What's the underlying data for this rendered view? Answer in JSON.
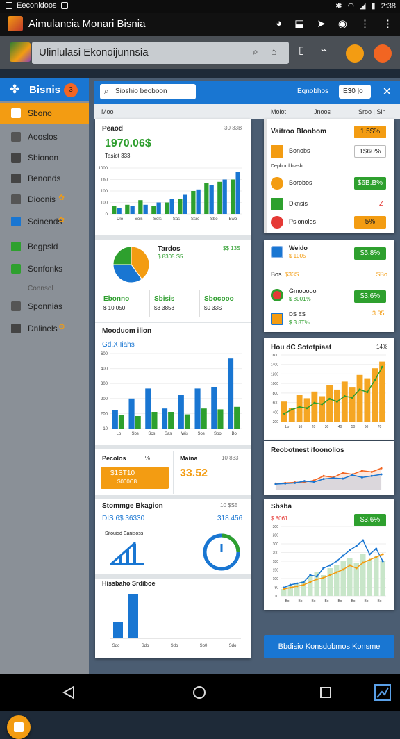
{
  "status_bar": {
    "left_text": "Eeconidoos",
    "time": "2:38"
  },
  "titlebar": {
    "title": "Aimulancia Monari Bisnia"
  },
  "address_bar": {
    "url": "Ulinlulasi Ekonoijunnsia"
  },
  "sidebar": {
    "title": "Bisnis",
    "badge": "3",
    "items": [
      {
        "label": "Sbono",
        "active": true,
        "icon": "chart-icon"
      },
      {
        "label": "Aooslos",
        "icon": "bar-icon"
      },
      {
        "label": "Sbionon",
        "icon": "doc-icon"
      },
      {
        "label": "Benonds",
        "icon": "doc-icon"
      },
      {
        "label": "Dioonis",
        "extra": "✿",
        "icon": "gear-icon"
      },
      {
        "label": "Scinends",
        "extra": "✿",
        "icon": "calendar-icon"
      },
      {
        "label": "Begpsld",
        "icon": "green-doc-icon"
      },
      {
        "label": "Sonfonks",
        "icon": "green-doc-icon"
      },
      {
        "label": "Connsol",
        "muted": true
      },
      {
        "label": "Sponnias",
        "icon": "gear-icon"
      },
      {
        "label": "Dnlinels",
        "extra": "⚙",
        "icon": "doc-icon"
      }
    ]
  },
  "toolbar": {
    "search_placeholder": "Sioshio beoboon",
    "link": "Eqnobhos",
    "button": "E30 |o",
    "close": "✕"
  },
  "column_header": {
    "c1": "Moo",
    "c2": "Moiot",
    "c3": "Jnoos",
    "c4": "Sroo | Sln"
  },
  "left": {
    "card1": {
      "title": "Peaod",
      "corner": "30 33B",
      "value": "1970.06$",
      "sub": "Tasiot 333",
      "yticks": [
        "1000",
        "160",
        "100",
        "100",
        "0"
      ],
      "xticks": [
        "Dlo",
        "Sols",
        "Sols",
        "Sas",
        "Ssro",
        "Sbo",
        "Bwo"
      ]
    },
    "pie": {
      "title": "Tardos",
      "corner": "$$ 13S",
      "sub": "$ 8305.S5",
      "slices": [
        {
          "label": "Orange",
          "value": 40,
          "color": "#f39c12"
        },
        {
          "label": "Blue",
          "value": 35,
          "color": "#1976d2"
        },
        {
          "label": "Green",
          "value": 25,
          "color": "#2ea02e"
        }
      ],
      "stats": [
        {
          "value": "Ebonno",
          "sub": "$ 10 050"
        },
        {
          "value": "Sbisis",
          "sub": "$3 3853"
        },
        {
          "value": "Sbocooo",
          "sub": "$0 33S"
        }
      ]
    },
    "card3": {
      "title": "Mooduom ilion",
      "sub": "Gd.X Iiahs",
      "yticks": [
        "600",
        "400",
        "300",
        "200",
        "200",
        "10"
      ],
      "xticks": [
        "Lo",
        "Sbs",
        "Scs",
        "Sas",
        "Wis",
        "Sos",
        "Sbo",
        "Bo"
      ]
    },
    "card4": {
      "left_title": "Pecolos",
      "left_corner": "%",
      "pill": "$1ST10",
      "pill_sub": "$000C8",
      "right_title": "Maina",
      "right_corner": "10 833",
      "right_value": "33.52"
    },
    "card5": {
      "title": "Stommge Bkagion",
      "corner": "10 $S5",
      "left_value": "DIS 6$ 36330",
      "right_value": "318.456",
      "sub": "Sitouisd Eanisoss"
    },
    "card6": {
      "title": "Hissbaho Srdiboe",
      "xticks": [
        "Sdo",
        "Sdo",
        "Sdo",
        "Sb0",
        "Sdo"
      ]
    }
  },
  "right": {
    "card1": {
      "title": "Vaitroo Blonbom",
      "pill": "1 5$%",
      "rows": [
        {
          "label": "Bonobs",
          "pill": "1$60%",
          "pill_style": "w"
        },
        {
          "label": "Depbord blasb",
          "pill": "",
          "pill_style": ""
        },
        {
          "label": "Borobos",
          "pill": "$6B.B%",
          "pill_style": "g"
        },
        {
          "label": "Dknsis",
          "pill": "Z",
          "pill_style": "x"
        },
        {
          "label": "Psionolos",
          "pill": "5%",
          "pill_style": "o"
        }
      ]
    },
    "card2": {
      "title": "Weido",
      "sub": "$ 1005",
      "pill": "$5.8%",
      "row2_label": "Bos",
      "row2_value": "$33$",
      "row2_right": "$Bo",
      "row3_title": "Gmooooo",
      "row3_sub": "$ 8001%",
      "row3_pill": "$3.6%",
      "row4_a": "DS ES",
      "row4_b": "$ 3.8T%",
      "row4_right": "3.35"
    },
    "card3": {
      "title": "Hou dC Sototpiaat",
      "corner": "14%",
      "bars": [
        30,
        20,
        40,
        35,
        45,
        38,
        55,
        48,
        60,
        52,
        70,
        65,
        80,
        90
      ],
      "line": [
        12,
        18,
        22,
        20,
        28,
        26,
        34,
        30,
        38,
        36,
        48,
        44,
        62,
        82
      ],
      "yticks": [
        "1600",
        "1400",
        "1200",
        "1000",
        "800",
        "600",
        "400",
        "200"
      ],
      "xticks": [
        "Lo",
        "10",
        "20",
        "30",
        "40",
        "50",
        "60",
        "70"
      ]
    },
    "card4": {
      "title": "Reobotnest ifoonolios",
      "line_a": [
        20,
        22,
        24,
        25,
        30,
        45,
        40,
        55,
        50,
        62,
        58,
        70
      ],
      "line_b": [
        18,
        20,
        22,
        28,
        25,
        35,
        38,
        36,
        48,
        40,
        45,
        50
      ]
    },
    "card5": {
      "title": "Sbsba",
      "pill": "$3.6%",
      "sub": "$ 8061",
      "yticks": [
        "300",
        "280",
        "300",
        "200",
        "180",
        "150",
        "100",
        "80",
        "10"
      ],
      "bars": [
        10,
        14,
        18,
        22,
        28,
        35,
        30,
        40,
        45,
        50,
        55,
        48,
        60,
        52,
        58,
        50
      ],
      "line_a": [
        12,
        16,
        18,
        20,
        30,
        28,
        40,
        44,
        50,
        58,
        66,
        72,
        80,
        60,
        68,
        50
      ],
      "line_b": [
        10,
        12,
        14,
        16,
        20,
        24,
        26,
        30,
        34,
        38,
        44,
        40,
        48,
        52,
        56,
        60
      ],
      "xticks": [
        "Bo",
        "Bo",
        "Bo",
        "Bo",
        "Bo",
        "Bo",
        "Bo",
        "Bo"
      ]
    },
    "button": "Bbdisio Konsdobmos Konsme"
  },
  "chart_data": [
    {
      "type": "bar",
      "title": "Peaod",
      "categories": [
        "Dlo",
        "Sols",
        "Sols",
        "Sas",
        "Ssro",
        "Sbo",
        "Bwo"
      ],
      "series": [
        {
          "name": "",
          "values": [
            10,
            12,
            18,
            10,
            15,
            20,
            30,
            40,
            42,
            45
          ]
        },
        {
          "name": "",
          "values": [
            8,
            10,
            12,
            15,
            20,
            25,
            32,
            38,
            45,
            55
          ]
        }
      ]
    },
    {
      "type": "pie",
      "title": "Tardos",
      "categories": [
        "Orange",
        "Blue",
        "Green"
      ],
      "values": [
        40,
        35,
        25
      ]
    },
    {
      "type": "bar",
      "title": "Mooduom ilion",
      "categories": [
        "Lo",
        "Sbs",
        "Scs",
        "Sas",
        "Wis",
        "Sos",
        "Sbo",
        "Bo"
      ],
      "series": [
        {
          "name": "",
          "values": [
            110,
            180,
            240,
            120,
            200,
            240,
            250,
            420
          ]
        },
        {
          "name": "",
          "values": [
            80,
            75,
            100,
            100,
            85,
            120,
            115,
            130
          ]
        }
      ]
    },
    {
      "type": "bar",
      "title": "Hissbaho Srdiboe",
      "categories": [
        "Sdo",
        "Sdo"
      ],
      "series": [
        {
          "name": "",
          "values": [
            30,
            80
          ]
        }
      ]
    }
  ]
}
